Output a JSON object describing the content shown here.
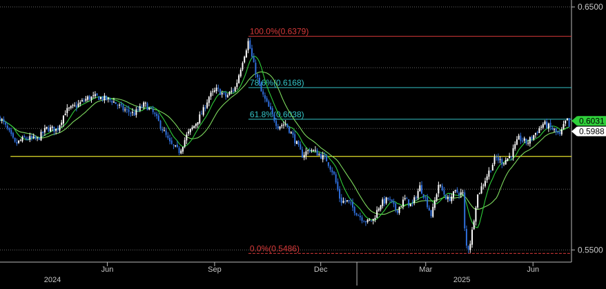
{
  "chart_data": {
    "type": "candlestick",
    "colors": {
      "background": "#000000",
      "candle_up": "#ffffff",
      "candle_down": "#2f6fdc",
      "ma_fast": "#2fd03a",
      "ma_slow": "#7fdc5f",
      "fib_100": "#d93a3a",
      "fib_0": "#d93a3a",
      "fib_786": "#35c5c9",
      "fib_618": "#35c5c9",
      "support": "#e5e02a",
      "axis_text": "#c8c8c8",
      "grid": "#6a6a6a"
    },
    "y_axis": {
      "min": 0.545,
      "max": 0.652,
      "ticks": [
        {
          "value": 0.65,
          "label": "0.6500"
        },
        {
          "value": 0.55,
          "label": "0.5500"
        }
      ],
      "gridlines": [
        0.65,
        0.625,
        0.6,
        0.575,
        0.55
      ]
    },
    "x_axis": {
      "start": "2024-03-01",
      "end": "2025-07-04",
      "month_ticks": [
        {
          "date": "2024-06-01",
          "label": "Jun"
        },
        {
          "date": "2024-09-01",
          "label": "Sep"
        },
        {
          "date": "2024-12-01",
          "label": "Dec"
        },
        {
          "date": "2025-03-01",
          "label": "Mar"
        },
        {
          "date": "2025-06-01",
          "label": "Jun"
        }
      ],
      "year_labels": [
        {
          "date": "2024-04-15",
          "label": "2024"
        },
        {
          "date": "2025-04-01",
          "label": "2025"
        }
      ],
      "year_divider": "2025-01-01"
    },
    "fib_levels": [
      {
        "label": "100.0%(0.6379)",
        "value": 0.6379,
        "start": "2024-09-30",
        "style": "fib_100"
      },
      {
        "label": "78.6%(0.6168)",
        "value": 0.6168,
        "start": "2024-09-30",
        "style": "fib_786"
      },
      {
        "label": "61.8%(0.6038)",
        "value": 0.6038,
        "start": "2024-09-30",
        "style": "fib_618"
      },
      {
        "label": "0.0%(0.5486)",
        "value": 0.5486,
        "start": "2024-09-30",
        "style": "fib_0"
      }
    ],
    "support_line": {
      "value": 0.5885,
      "start": "2024-03-10",
      "end": "2025-07-04"
    },
    "price_labels": [
      {
        "label": "0.6031",
        "value": 0.6031,
        "bg": "#2fd03a",
        "fg": "#000000"
      },
      {
        "label": "0.5988",
        "value": 0.5988,
        "bg": "#ffffff",
        "fg": "#000000"
      }
    ],
    "anchors": [
      [
        "2024-03-01",
        0.6045
      ],
      [
        "2024-03-08",
        0.599
      ],
      [
        "2024-03-14",
        0.5935
      ],
      [
        "2024-03-22",
        0.596
      ],
      [
        "2024-04-02",
        0.5955
      ],
      [
        "2024-04-10",
        0.6
      ],
      [
        "2024-04-19",
        0.5995
      ],
      [
        "2024-04-26",
        0.607
      ],
      [
        "2024-05-06",
        0.6095
      ],
      [
        "2024-05-15",
        0.6125
      ],
      [
        "2024-05-23",
        0.613
      ],
      [
        "2024-06-05",
        0.6115
      ],
      [
        "2024-06-14",
        0.608
      ],
      [
        "2024-06-24",
        0.606
      ],
      [
        "2024-07-03",
        0.61
      ],
      [
        "2024-07-11",
        0.606
      ],
      [
        "2024-07-18",
        0.6
      ],
      [
        "2024-07-25",
        0.5935
      ],
      [
        "2024-08-02",
        0.5905
      ],
      [
        "2024-08-08",
        0.597
      ],
      [
        "2024-08-15",
        0.6015
      ],
      [
        "2024-08-22",
        0.607
      ],
      [
        "2024-08-27",
        0.613
      ],
      [
        "2024-09-03",
        0.616
      ],
      [
        "2024-09-11",
        0.613
      ],
      [
        "2024-09-19",
        0.617
      ],
      [
        "2024-09-25",
        0.628
      ],
      [
        "2024-09-30",
        0.636
      ],
      [
        "2024-10-04",
        0.627
      ],
      [
        "2024-10-11",
        0.615
      ],
      [
        "2024-10-18",
        0.608
      ],
      [
        "2024-10-25",
        0.601
      ],
      [
        "2024-11-01",
        0.602
      ],
      [
        "2024-11-08",
        0.596
      ],
      [
        "2024-11-15",
        0.589
      ],
      [
        "2024-11-22",
        0.5915
      ],
      [
        "2024-11-29",
        0.5895
      ],
      [
        "2024-12-06",
        0.587
      ],
      [
        "2024-12-12",
        0.5815
      ],
      [
        "2024-12-18",
        0.57
      ],
      [
        "2024-12-24",
        0.57
      ],
      [
        "2025-01-03",
        0.564
      ],
      [
        "2025-01-10",
        0.5615
      ],
      [
        "2025-01-15",
        0.5625
      ],
      [
        "2025-01-21",
        0.569
      ],
      [
        "2025-01-28",
        0.571
      ],
      [
        "2025-02-04",
        0.566
      ],
      [
        "2025-02-11",
        0.571
      ],
      [
        "2025-02-17",
        0.568
      ],
      [
        "2025-02-24",
        0.576
      ],
      [
        "2025-02-28",
        0.572
      ],
      [
        "2025-03-06",
        0.564
      ],
      [
        "2025-03-12",
        0.577
      ],
      [
        "2025-03-20",
        0.5705
      ],
      [
        "2025-03-27",
        0.574
      ],
      [
        "2025-04-02",
        0.573
      ],
      [
        "2025-04-04",
        0.552
      ],
      [
        "2025-04-07",
        0.5506
      ],
      [
        "2025-04-09",
        0.555
      ],
      [
        "2025-04-14",
        0.572
      ],
      [
        "2025-04-22",
        0.58
      ],
      [
        "2025-04-30",
        0.588
      ],
      [
        "2025-05-06",
        0.586
      ],
      [
        "2025-05-13",
        0.589
      ],
      [
        "2025-05-20",
        0.596
      ],
      [
        "2025-05-27",
        0.594
      ],
      [
        "2025-06-03",
        0.598
      ],
      [
        "2025-06-10",
        0.602
      ],
      [
        "2025-06-17",
        0.6
      ],
      [
        "2025-06-24",
        0.597
      ],
      [
        "2025-06-30",
        0.604
      ],
      [
        "2025-07-03",
        0.5988
      ]
    ],
    "candle_spacing_days": 1.6
  }
}
